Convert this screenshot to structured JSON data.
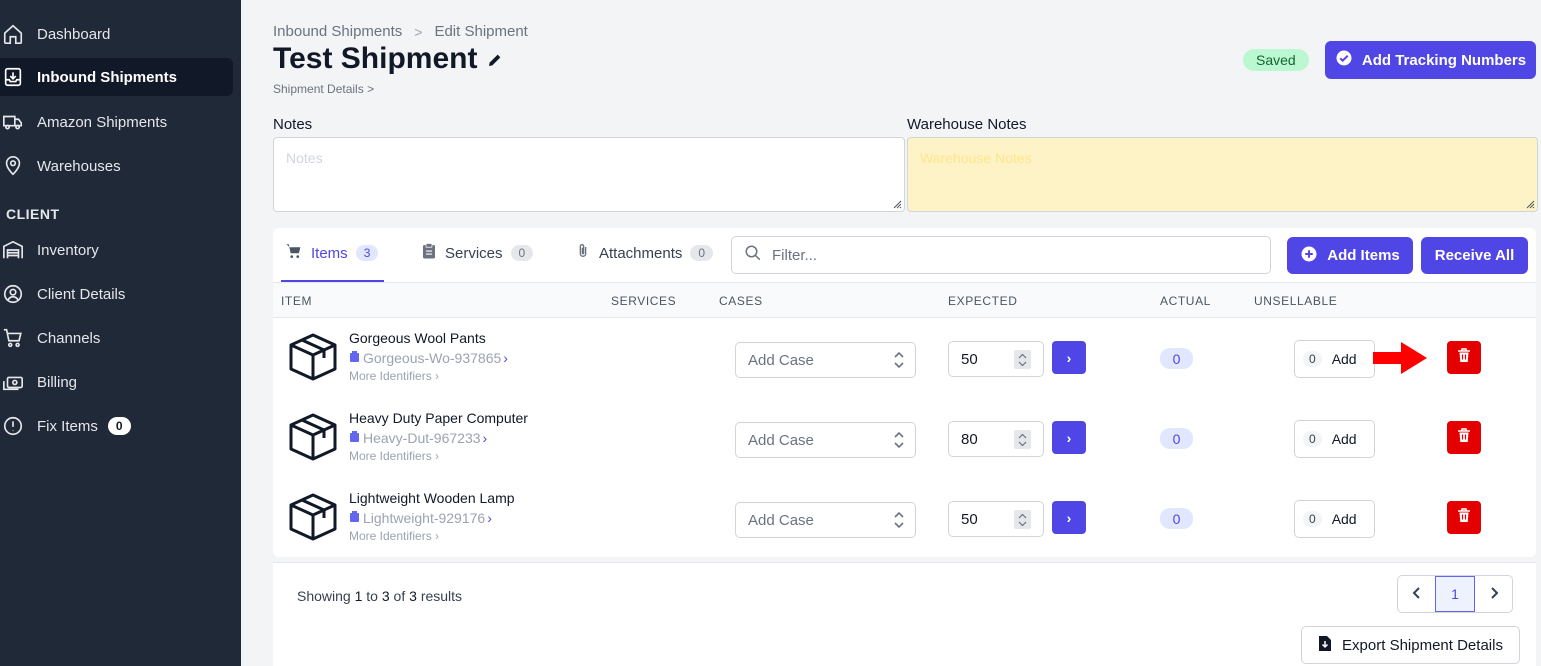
{
  "sidebar": {
    "items": [
      {
        "label": "Dashboard",
        "icon": "home-icon"
      },
      {
        "label": "Inbound Shipments",
        "icon": "inbox-download-icon"
      },
      {
        "label": "Amazon Shipments",
        "icon": "truck-icon"
      },
      {
        "label": "Warehouses",
        "icon": "map-pin-icon"
      }
    ],
    "section_label": "CLIENT",
    "client_items": [
      {
        "label": "Inventory",
        "icon": "warehouse-icon"
      },
      {
        "label": "Client Details",
        "icon": "user-circle-icon"
      },
      {
        "label": "Channels",
        "icon": "cart-icon"
      },
      {
        "label": "Billing",
        "icon": "cash-icon"
      },
      {
        "label": "Fix Items",
        "icon": "alert-circle-icon",
        "badge": "0"
      }
    ]
  },
  "breadcrumb": {
    "parent": "Inbound Shipments",
    "sep": ">",
    "current": "Edit Shipment"
  },
  "page": {
    "title": "Test Shipment",
    "subcrumb": "Shipment Details",
    "subcrumb_chevron": ">"
  },
  "status": {
    "saved": "Saved"
  },
  "actions": {
    "add_tracking": "Add Tracking Numbers",
    "add_items": "Add Items",
    "receive_all": "Receive All",
    "export": "Export Shipment Details"
  },
  "notes": {
    "label": "Notes",
    "placeholder": "Notes",
    "warehouse_label": "Warehouse Notes",
    "warehouse_placeholder": "Warehouse Notes"
  },
  "tabs": [
    {
      "label": "Items",
      "count": "3"
    },
    {
      "label": "Services",
      "count": "0"
    },
    {
      "label": "Attachments",
      "count": "0"
    }
  ],
  "filter": {
    "placeholder": "Filter..."
  },
  "columns": [
    "ITEM",
    "SERVICES",
    "CASES",
    "EXPECTED",
    "ACTUAL",
    "UNSELLABLE"
  ],
  "rows": [
    {
      "name": "Gorgeous Wool Pants",
      "sku": "Gorgeous-Wo-937865",
      "more": "More Identifiers",
      "case": "Add Case",
      "expected": "50",
      "actual": "0",
      "unsellable": "0",
      "add": "Add"
    },
    {
      "name": "Heavy Duty Paper Computer",
      "sku": "Heavy-Dut-967233",
      "more": "More Identifiers",
      "case": "Add Case",
      "expected": "80",
      "actual": "0",
      "unsellable": "0",
      "add": "Add"
    },
    {
      "name": "Lightweight Wooden Lamp",
      "sku": "Lightweight-929176",
      "more": "More Identifiers",
      "case": "Add Case",
      "expected": "50",
      "actual": "0",
      "unsellable": "0",
      "add": "Add"
    }
  ],
  "footer": {
    "showing_prefix": "Showing",
    "from": "1",
    "to_word": "to",
    "to": "3",
    "of_word": "of",
    "total": "3",
    "suffix": "results",
    "page": "1"
  },
  "colors": {
    "accent": "#4f46e5",
    "danger": "#e50000",
    "sidebar": "#1f2937",
    "saved_bg": "#bbf7d0",
    "warehouse_notes_bg": "#fef3c7"
  }
}
